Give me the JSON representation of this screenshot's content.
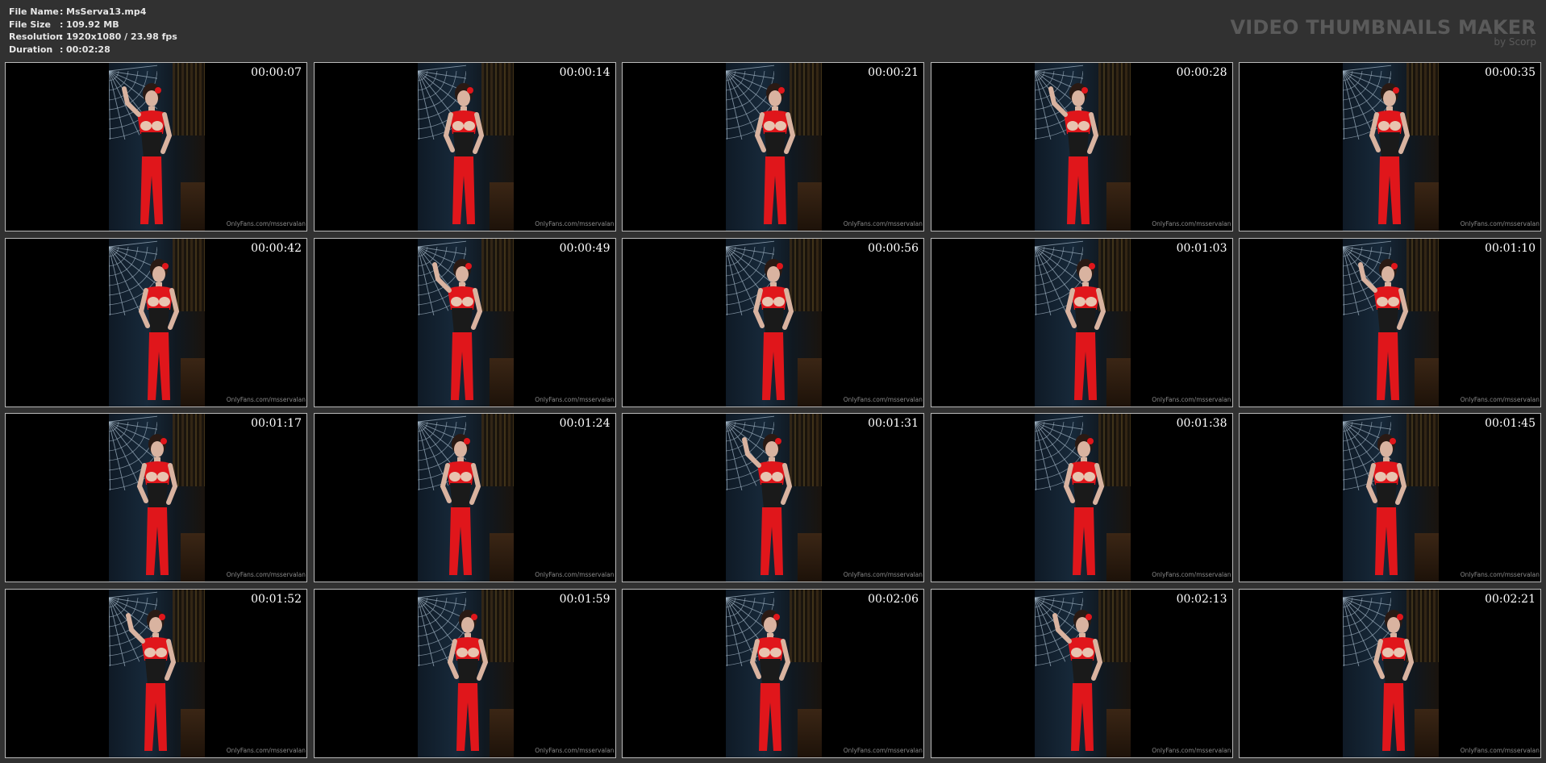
{
  "info": {
    "rows": [
      {
        "label": "File Name",
        "sep": ":",
        "value": "MsServa13.mp4"
      },
      {
        "label": "File Size",
        "sep": ":",
        "value": "109.92 MB"
      },
      {
        "label": "Resolution",
        "sep": ":",
        "value": "1920x1080 / 23.98 fps"
      },
      {
        "label": "Duration",
        "sep": ":",
        "value": "00:02:28"
      }
    ]
  },
  "brand": {
    "title": "VIDEO THUMBNAILS MAKER",
    "subtitle": "by Scorp"
  },
  "colors": {
    "background": "#313131",
    "border": "#b9b9b9",
    "latex_red": "#e0161b",
    "corset": "#1a1a1a"
  },
  "thumbnails": [
    {
      "time": "00:00:07",
      "watermark": "OnlyFans.com/msservalan"
    },
    {
      "time": "00:00:14",
      "watermark": "OnlyFans.com/msservalan"
    },
    {
      "time": "00:00:21",
      "watermark": "OnlyFans.com/msservalan"
    },
    {
      "time": "00:00:28",
      "watermark": "OnlyFans.com/msservalan"
    },
    {
      "time": "00:00:35",
      "watermark": "OnlyFans.com/msservalan"
    },
    {
      "time": "00:00:42",
      "watermark": "OnlyFans.com/msservalan"
    },
    {
      "time": "00:00:49",
      "watermark": "OnlyFans.com/msservalan"
    },
    {
      "time": "00:00:56",
      "watermark": "OnlyFans.com/msservalan"
    },
    {
      "time": "00:01:03",
      "watermark": "OnlyFans.com/msservalan"
    },
    {
      "time": "00:01:10",
      "watermark": "OnlyFans.com/msservalan"
    },
    {
      "time": "00:01:17",
      "watermark": "OnlyFans.com/msservalan"
    },
    {
      "time": "00:01:24",
      "watermark": "OnlyFans.com/msservalan"
    },
    {
      "time": "00:01:31",
      "watermark": "OnlyFans.com/msservalan"
    },
    {
      "time": "00:01:38",
      "watermark": "OnlyFans.com/msservalan"
    },
    {
      "time": "00:01:45",
      "watermark": "OnlyFans.com/msservalan"
    },
    {
      "time": "00:01:52",
      "watermark": "OnlyFans.com/msservalan"
    },
    {
      "time": "00:01:59",
      "watermark": "OnlyFans.com/msservalan"
    },
    {
      "time": "00:02:06",
      "watermark": "OnlyFans.com/msservalan"
    },
    {
      "time": "00:02:13",
      "watermark": "OnlyFans.com/msservalan"
    },
    {
      "time": "00:02:21",
      "watermark": "OnlyFans.com/msservalan"
    }
  ]
}
